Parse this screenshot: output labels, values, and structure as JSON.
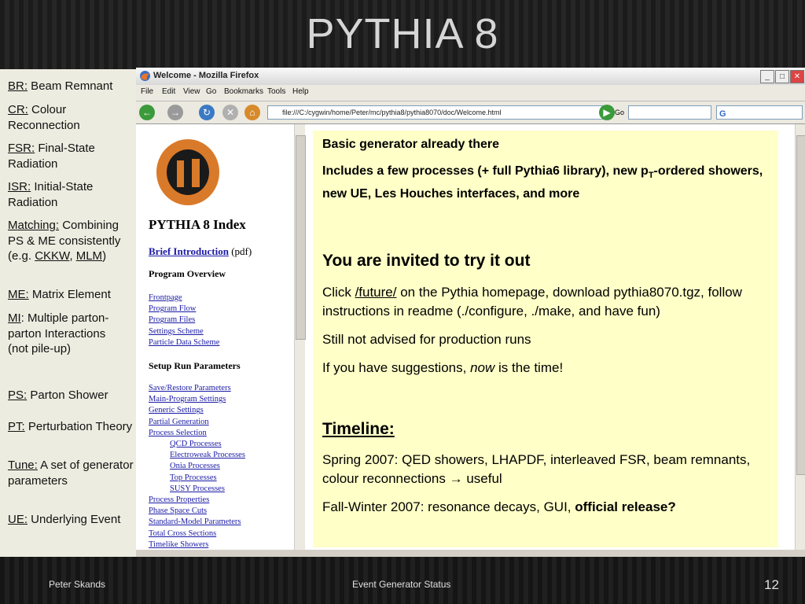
{
  "slide": {
    "title": "PYTHIA 8",
    "footer_left": "Peter Skands",
    "footer_center": "Event Generator Status",
    "page_number": "12"
  },
  "sidebar": [
    {
      "abbr": "BR:",
      "text": " Beam Remnant"
    },
    {
      "abbr": "CR:",
      "text": " Colour Reconnection"
    },
    {
      "abbr": "FSR:",
      "text": " Final-State Radiation"
    },
    {
      "abbr": "ISR:",
      "text": " Initial-State Radiation"
    },
    {
      "abbr": "Matching:",
      "text": " Combining PS & ME consistently (e.g.",
      "link1": "CKKW",
      "sep": ",",
      "link2": "MLM",
      "end": ")"
    },
    {
      "abbr": "ME:",
      "text": " Matrix Element"
    },
    {
      "abbr": "MI",
      "text": ": Multiple parton-parton Interactions",
      "extra": "(not pile-up)"
    },
    {
      "abbr": "PS:",
      "text": " Parton Shower"
    },
    {
      "abbr": "PT:",
      "text": " Perturbation Theory"
    },
    {
      "abbr": "Tune:",
      "text": " A set of generator parameters"
    },
    {
      "abbr": "UE:",
      "text": " Underlying Event"
    }
  ],
  "browser": {
    "title": "Welcome - Mozilla Firefox",
    "menu": [
      "File",
      "Edit",
      "View",
      "Go",
      "Bookmarks",
      "Tools",
      "Help"
    ],
    "url": "file:///C:/cygwin/home/Peter/mc/pythia8/pythia8070/doc/Welcome.html",
    "go_label": "Go",
    "search_engine": "G"
  },
  "index": {
    "heading": "PYTHIA 8 Index",
    "brief_link": "Brief Introduction",
    "pdf": " (pdf)",
    "overview_title": "Program Overview",
    "overview": [
      "Frontpage",
      "Program Flow",
      "Program Files",
      "Settings Scheme",
      "Particle Data Scheme"
    ],
    "setup_title": "Setup Run Parameters",
    "setup": [
      "Save/Restore Parameters",
      "Main-Program Settings",
      "Generic Settings",
      "Partial Generation",
      "Process Selection",
      "QCD Processes",
      "Electroweak Processes",
      "Onia Processes",
      "Top Processes",
      "SUSY Processes",
      "Process Properties",
      "Phase Space Cuts",
      "Standard-Model Parameters",
      "Total Cross Sections",
      "Timelike Showers"
    ],
    "indented": [
      false,
      false,
      false,
      false,
      false,
      true,
      true,
      true,
      true,
      true,
      false,
      false,
      false,
      false,
      false
    ]
  },
  "note": {
    "p1": "Basic generator already there",
    "p2a": "Includes a few processes (+ full Pythia6 library), new p",
    "p2sub": "T",
    "p2b": "-ordered showers, new UE, Les Houches interfaces, and more",
    "h1": "You are invited to try it out",
    "p3a": "Click ",
    "p3link": "/future/",
    "p3b": " on the Pythia homepage, download pythia8070.tgz, follow instructions in readme (./configure, ./make, and have fun)",
    "p4": "Still not advised for production runs",
    "p5a": "If you have suggestions, ",
    "p5em": "now",
    "p5b": " is the time!",
    "h2": "Timeline:",
    "p6": "Spring 2007: QED showers, LHAPDF, interleaved FSR, beam remnants, colour reconnections → useful",
    "p7a": "Fall-Winter 2007: resonance decays, GUI, ",
    "p7b": "official release?"
  }
}
